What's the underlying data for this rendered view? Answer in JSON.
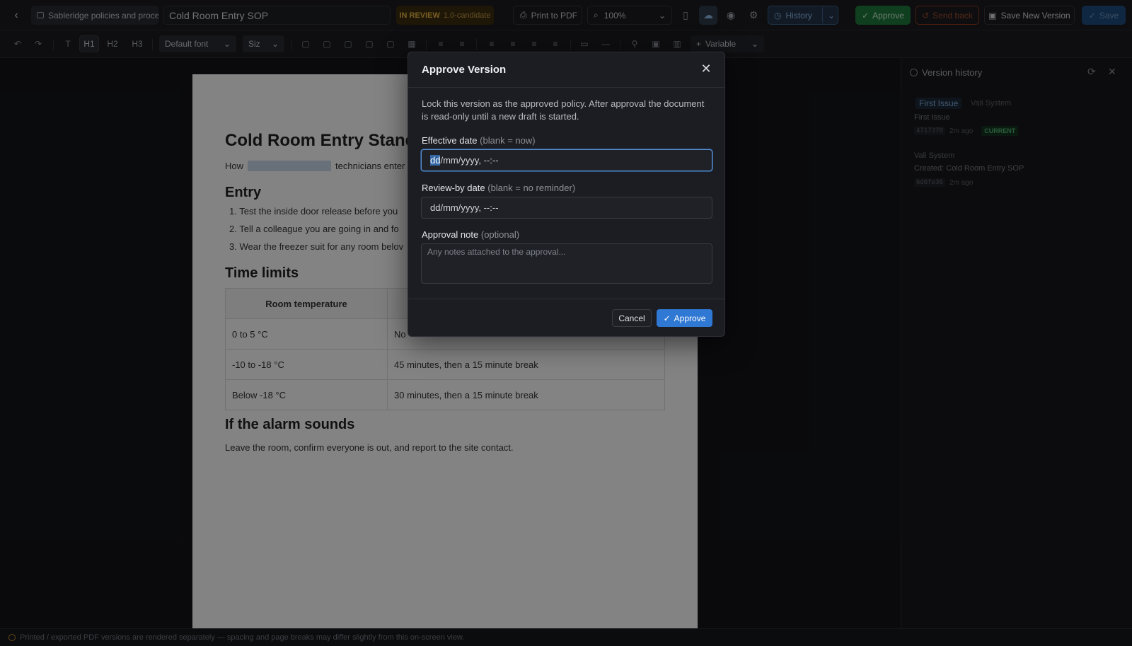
{
  "topbar": {
    "back_icon": "chevron-left-icon",
    "folder_name": "Sableridge policies and proce",
    "doc_title": "Cold Room Entry SOP",
    "status": "IN REVIEW",
    "version_label": "1.0-candidate",
    "print_label": "Print to PDF",
    "zoom": "100%",
    "history_label": "History",
    "approve_label": "Approve",
    "send_back_label": "Send back",
    "save_new_label": "Save New Version",
    "save_label": "Save"
  },
  "toolbar": {
    "h1": "H1",
    "h2": "H2",
    "h3": "H3",
    "font": "Default font",
    "size": "Siz",
    "variable": "Variable"
  },
  "document": {
    "title": "Cold Room Entry Stand",
    "intro_before": "How",
    "intro_after": "technicians enter",
    "section_entry": "Entry",
    "entry_items": [
      "1. Test the inside door release before you",
      "2. Tell a colleague you are going in and fo",
      "3. Wear the freezer suit for any room belov"
    ],
    "section_time": "Time limits",
    "table_header": [
      "Room temperature",
      ""
    ],
    "table_rows": [
      [
        "0 to 5 °C",
        "No"
      ],
      [
        "-10 to -18 °C",
        "45 minutes, then a 15 minute break"
      ],
      [
        "Below -18 °C",
        "30 minutes, then a 15 minute break"
      ]
    ],
    "section_alarm": "If the alarm sounds",
    "alarm_text": "Leave the room, confirm everyone is out, and report to the site contact."
  },
  "history_panel": {
    "title": "Version history",
    "entries": [
      {
        "tag": "First Issue",
        "tag2": "Vali System",
        "name": "First Issue",
        "hash": "4717370",
        "time": "2m ago",
        "badge": "CURRENT"
      },
      {
        "tag": "Vali System",
        "name": "Created: Cold Room Entry SOP",
        "hash": "6d6fe36",
        "time": "2m ago"
      }
    ]
  },
  "footer": {
    "note": "Printed / exported PDF versions are rendered separately — spacing and page breaks may differ slightly from this on-screen view."
  },
  "modal": {
    "title": "Approve Version",
    "description": "Lock this version as the approved policy. After approval the document is read-only until a new draft is started.",
    "effective_label": "Effective date",
    "effective_hint": "(blank = now)",
    "effective_sel": "dd",
    "effective_rest": "/mm/yyyy, --:--",
    "review_label": "Review-by date",
    "review_hint": "(blank = no reminder)",
    "review_value": "dd/mm/yyyy, --:--",
    "note_label": "Approval note",
    "note_hint": "(optional)",
    "note_placeholder": "Any notes attached to the approval...",
    "cancel_label": "Cancel",
    "approve_label": "Approve"
  },
  "colors": {
    "accent": "#2f78d4",
    "approve_green": "#1e7a3a",
    "review_amber": "#e7b243",
    "send_back": "#9c4b2a"
  }
}
